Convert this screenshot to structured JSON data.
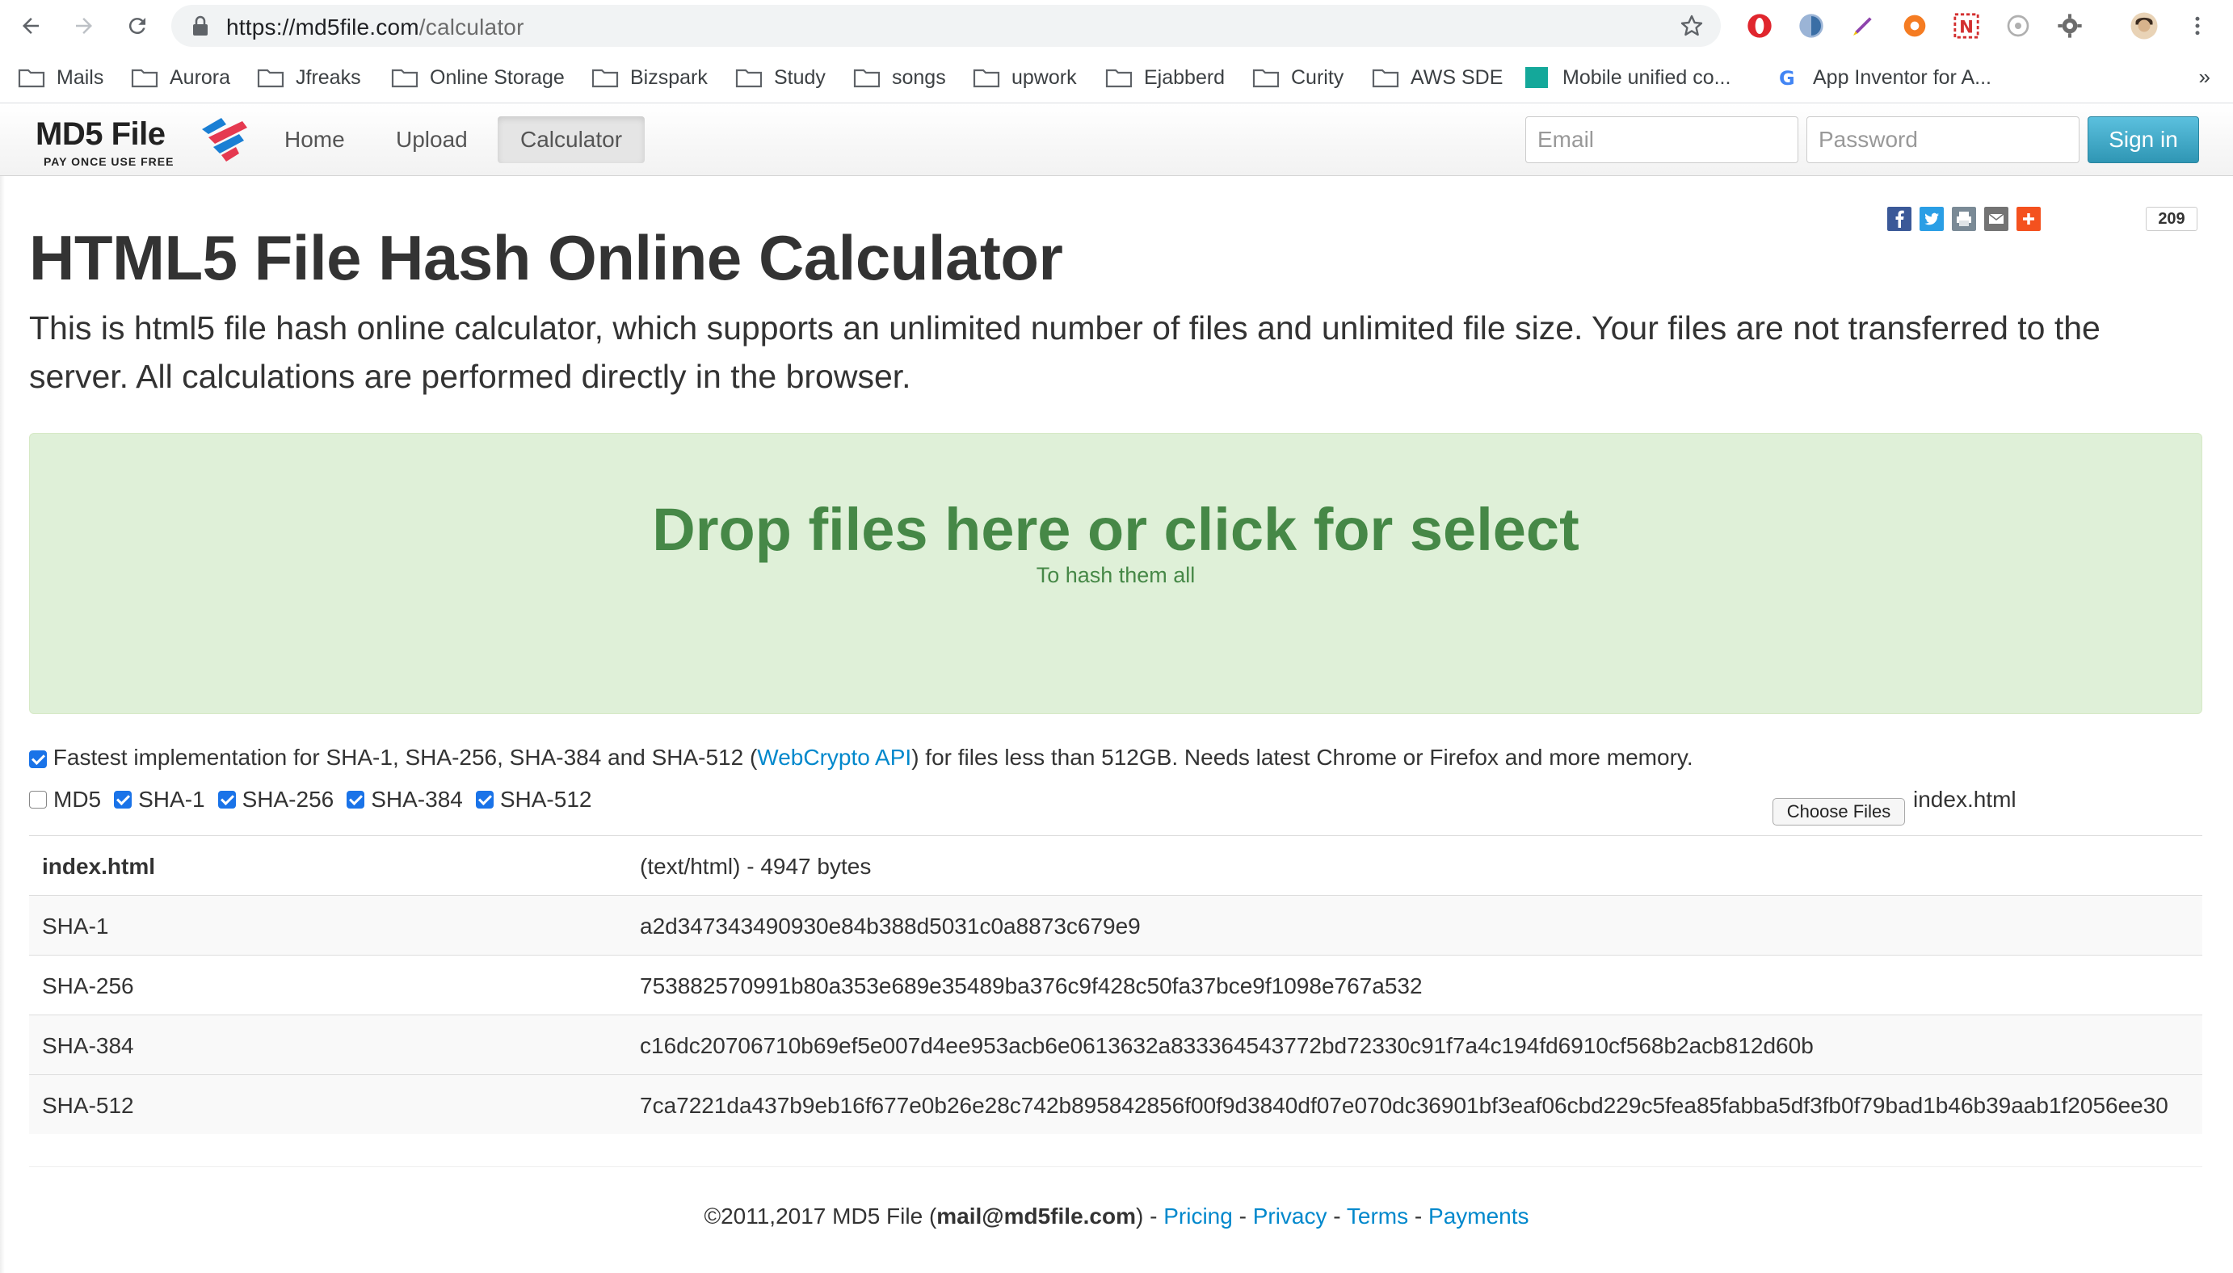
{
  "browser": {
    "url_host": "https://md5file.com",
    "url_path": "/calculator",
    "bookmarks": [
      {
        "label": "Mails"
      },
      {
        "label": "Aurora"
      },
      {
        "label": "Jfreaks"
      },
      {
        "label": "Online Storage"
      },
      {
        "label": "Bizspark"
      },
      {
        "label": "Study"
      },
      {
        "label": "songs"
      },
      {
        "label": "upwork"
      },
      {
        "label": "Ejabberd"
      },
      {
        "label": "Curity"
      },
      {
        "label": "AWS SDE"
      },
      {
        "label": "Mobile unified co..."
      },
      {
        "label": "App Inventor for A..."
      }
    ],
    "more_label": "»"
  },
  "site": {
    "logo_text": "MD5 File",
    "logo_tagline": "PAY ONCE USE FREE",
    "nav": {
      "home": "Home",
      "upload": "Upload",
      "calculator": "Calculator"
    },
    "email_placeholder": "Email",
    "password_placeholder": "Password",
    "signin_label": "Sign in",
    "share_count": "209",
    "colors": {
      "facebook": "#3b5998",
      "twitter": "#2a9ee5",
      "print": "#7a8a96",
      "mail": "#737373",
      "plus": "#f4511e",
      "dropzone_bg": "#dff0d8",
      "dropzone_text": "#468847",
      "signin": "#2f96b4"
    }
  },
  "page": {
    "title": "HTML5 File Hash Online Calculator",
    "lead": "This is html5 file hash online calculator, which supports an unlimited number of files and unlimited file size. Your files are not transferred to the server. All calculations are performed directly in the browser.",
    "dropzone_title": "Drop files here or click for select",
    "dropzone_subtitle": "To hash them all",
    "fast_option": {
      "checked": true,
      "text_before": "Fastest implementation for SHA-1, SHA-256, SHA-384 and SHA-512 (",
      "link": "WebCrypto API",
      "text_after": ") for files less than 512GB. Needs latest Chrome or Firefox and more memory."
    },
    "algorithms": [
      {
        "label": "MD5",
        "checked": false
      },
      {
        "label": "SHA-1",
        "checked": true
      },
      {
        "label": "SHA-256",
        "checked": true
      },
      {
        "label": "SHA-384",
        "checked": true
      },
      {
        "label": "SHA-512",
        "checked": true
      }
    ],
    "choose_files_label": "Choose Files",
    "chosen_file": "index.html",
    "results": [
      {
        "name": "index.html",
        "value": "(text/html) - 4947 bytes"
      },
      {
        "name": "SHA-1",
        "value": "a2d347343490930e84b388d5031c0a8873c679e9"
      },
      {
        "name": "SHA-256",
        "value": "753882570991b80a353e689e35489ba376c9f428c50fa37bce9f1098e767a532"
      },
      {
        "name": "SHA-384",
        "value": "c16dc20706710b69ef5e007d4ee953acb6e0613632a833364543772bd72330c91f7a4c194fd6910cf568b2acb812d60b"
      },
      {
        "name": "SHA-512",
        "value": "7ca7221da437b9eb16f677e0b26e28c742b895842856f00f9d3840df07e070dc36901bf3eaf06cbd229c5fea85fabba5df3fb0f79bad1b46b39aab1f2056ee30"
      }
    ]
  },
  "footer": {
    "copyright": "©2011,2017 MD5 File (",
    "email": "mail@md5file.com",
    "after_email": ") - ",
    "pricing": "Pricing",
    "privacy": "Privacy",
    "terms": "Terms",
    "payments": "Payments",
    "sep": " - "
  }
}
